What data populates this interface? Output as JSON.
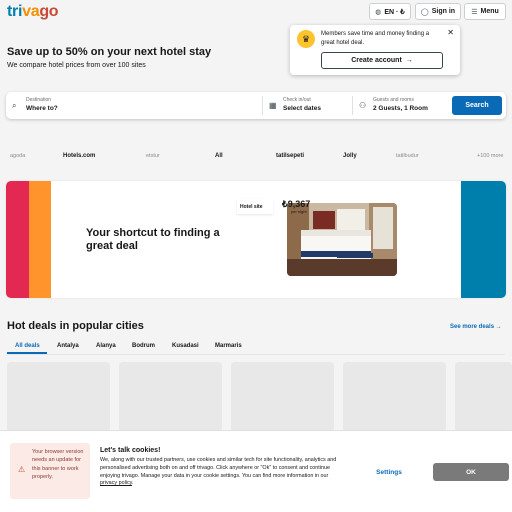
{
  "brand": {
    "part1": "tri",
    "part2": "va",
    "part3": "go"
  },
  "header": {
    "lang_label": "EN · ₺",
    "signin_label": "Sign in",
    "menu_label": "Menu"
  },
  "popup": {
    "text": "Members save time and money finding a great hotel deal.",
    "cta_label": "Create account",
    "close_label": "✕"
  },
  "hero": {
    "title": "Save up to 50% on your next hotel stay",
    "subtitle": "We compare hotel prices from over 100 sites"
  },
  "search": {
    "destination_label": "Destination",
    "destination_value": "Where to?",
    "checkin_label": "Check in/out",
    "checkin_value": "Select dates",
    "guests_label": "Guests and rooms",
    "guests_value": "2 Guests, 1 Room",
    "button_label": "Search"
  },
  "partners": [
    {
      "name": "agoda"
    },
    {
      "name": "Hotels.com"
    },
    {
      "name": "etstur"
    },
    {
      "name": "All"
    },
    {
      "name": "tatilsepeti"
    },
    {
      "name": "Jolly"
    },
    {
      "name": "tatilbudur"
    },
    {
      "name": "+100 more"
    }
  ],
  "banner": {
    "headline": "Your shortcut to finding a great deal",
    "tag_label": "Hotel site",
    "price": "₺9,367",
    "price_sub": "per night",
    "colors": {
      "red": "#e32851",
      "orange": "#ff932c",
      "blue": "#007fad"
    }
  },
  "deals": {
    "title": "Hot deals in popular cities",
    "see_more": "See more deals",
    "tabs": [
      "All deals",
      "Antalya",
      "Alanya",
      "Bodrum",
      "Kusadasi",
      "Marmaris"
    ]
  },
  "cookie": {
    "warning": "Your browser version needs an update for this banner to work properly.",
    "title": "Let's talk cookies!",
    "body": "We, along with our trusted partners, use cookies and similar tech for site functionality, analytics and personalised advertising both on and off trivago. Click anywhere or \"Ok\" to consent and continue enjoying trivago. Manage your data in your cookie settings. You can find more information in our ",
    "link": "privacy policy",
    "settings_label": "Settings",
    "ok_label": "OK"
  }
}
